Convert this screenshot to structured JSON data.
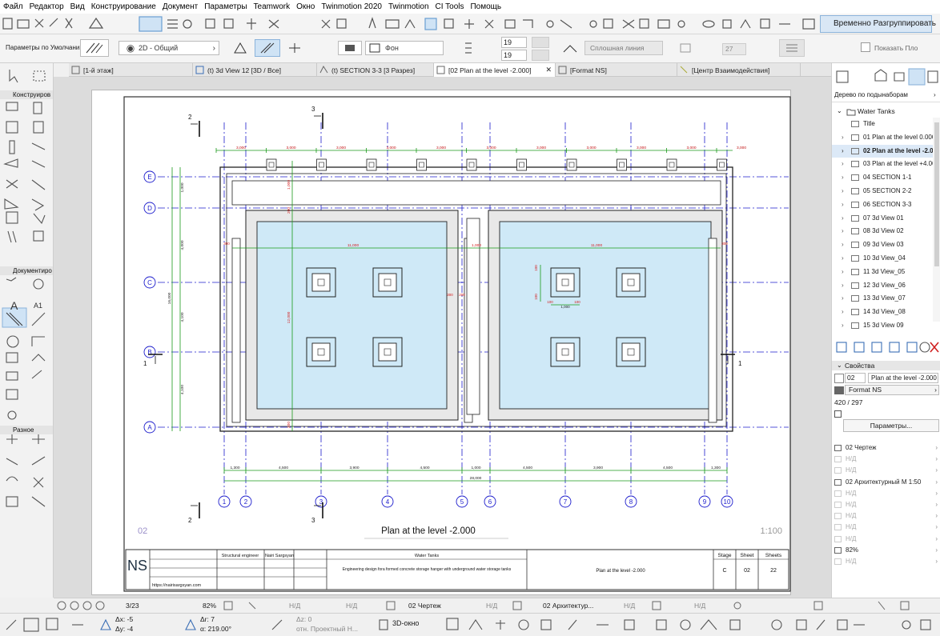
{
  "menu": [
    "Файл",
    "Редактор",
    "Вид",
    "Конструирование",
    "Документ",
    "Параметры",
    "Teamwork",
    "Окно",
    "Twinmotion 2020",
    "Twinmotion",
    "CI Tools",
    "Помощь"
  ],
  "toolbar": {
    "layer_value": "19",
    "pen_value": "19",
    "line_type": "Сплошная линия",
    "fill_value": "Фон",
    "zoom_field": "27",
    "show_label": "Показать Пло",
    "regroup_label": "Временно Разгруппировать",
    "defaults_label": "Параметры по Умолчанию",
    "view_label": "2D - Общий"
  },
  "tabs": [
    {
      "label": "[1-й этаж]",
      "icon": "floor-plan-icon"
    },
    {
      "label": "(t) 3d View 12 [3D / Все]",
      "icon": "3d-view-icon"
    },
    {
      "label": "(t) SECTION 3-3 [3 Разрез]",
      "icon": "section-icon"
    },
    {
      "label": "[02 Plan at the level -2.000]",
      "icon": "layout-icon",
      "active": true
    },
    {
      "label": "[Format NS]",
      "icon": "master-icon"
    },
    {
      "label": "[Центр Взаимодействия]",
      "icon": "collab-icon"
    }
  ],
  "left_sections": [
    "Конструиров",
    "Документиро",
    "Разное"
  ],
  "navigator": {
    "title": "Дерево по подынаборам",
    "root": "Water Tanks",
    "items": [
      {
        "label": "Title",
        "expander": false,
        "active": false
      },
      {
        "label": "01 Plan at the level 0.000",
        "expander": true,
        "active": false
      },
      {
        "label": "02 Plan at the level -2.000",
        "expander": true,
        "active": true
      },
      {
        "label": "03 Plan at the level +4.000",
        "expander": true,
        "active": false
      },
      {
        "label": "04 SECTION 1-1",
        "expander": true,
        "active": false
      },
      {
        "label": "05 SECTION 2-2",
        "expander": true,
        "active": false
      },
      {
        "label": "06 SECTION 3-3",
        "expander": true,
        "active": false
      },
      {
        "label": "07 3d View 01",
        "expander": true,
        "active": false
      },
      {
        "label": "08 3d View 02",
        "expander": true,
        "active": false
      },
      {
        "label": "09 3d View 03",
        "expander": true,
        "active": false
      },
      {
        "label": "10 3d View_04",
        "expander": true,
        "active": false
      },
      {
        "label": "11 3d View_05",
        "expander": true,
        "active": false
      },
      {
        "label": "12 3d View_06",
        "expander": true,
        "active": false
      },
      {
        "label": "13 3d View_07",
        "expander": true,
        "active": false
      },
      {
        "label": "14 3d View_08",
        "expander": true,
        "active": false
      },
      {
        "label": "15 3d View 09",
        "expander": true,
        "active": false
      }
    ]
  },
  "properties": {
    "title": "Свойства",
    "id": "02",
    "name": "Plan at the level -2.000",
    "master": "Format NS",
    "size": "420 / 297",
    "params_button": "Параметры...",
    "rows": [
      "02 Чертеж",
      "Н/Д",
      "Н/Д",
      "02 Архитектурный М 1:50",
      "Н/Д",
      "Н/Д",
      "Н/Д",
      "Н/Д",
      "Н/Д",
      "82%",
      "Н/Д"
    ]
  },
  "drawing": {
    "sheet_number": "02",
    "title": "Plan at the level -2.000",
    "scale": "1:100",
    "axes_letters": [
      "E",
      "D",
      "C",
      "B",
      "A"
    ],
    "axes_numbers": [
      "1",
      "2",
      "3",
      "4",
      "5",
      "6",
      "7",
      "8",
      "9",
      "10"
    ],
    "dims_top": [
      "3,000",
      "3,000",
      "3,000",
      "3,000",
      "3,000",
      "3,000",
      "3,000",
      "3,000",
      "3,000",
      "3,000",
      "3,000"
    ],
    "dims_bottom": [
      "1,300",
      "4,500",
      "3,900",
      "4,500",
      "1,000",
      "4,500",
      "3,900",
      "4,500",
      "1,300"
    ],
    "dim_total": "28,000",
    "dims_left": [
      "1,000",
      "4,000",
      "4,100",
      "4,100",
      "4,000"
    ],
    "dim_left_total": "16,000",
    "dim_inner_long": "11,000",
    "dim_col_small": "1,000",
    "dim_small": [
      "100",
      "100",
      "300",
      "200"
    ],
    "section_marks": [
      "1",
      "1",
      "2",
      "2",
      "3",
      "3"
    ]
  },
  "titleblock": {
    "role": "Structural engineer",
    "name": "Nairi Sargsyan",
    "url": "https://nairisargsyan.com",
    "project": "Water Tanks",
    "description": "Engineering design fora formed concrete storage hanger with underground water storage tanks",
    "drawing": "Plan at the level -2.000",
    "stage_label": "Stage",
    "sheet_label": "Sheet",
    "sheets_label": "Sheets",
    "stage": "C",
    "sheet": "02",
    "sheets": "22"
  },
  "statusbar": {
    "page": "3/23",
    "zoom": "82%",
    "na1": "Н/Д",
    "na2": "Н/Д",
    "layout": "02 Чертеж",
    "na3": "Н/Д",
    "scale": "02 Архитектур...",
    "na4": "Н/Д",
    "na5": "Н/Д"
  },
  "bottombar": {
    "dx": "Δx: -5",
    "dy": "Δy: -4",
    "dr": "Δr: 7",
    "da": "α: 219.00°",
    "dz": "Δz: 0",
    "ref": "отн. Проектный Н...",
    "view3d": "3D-окно"
  },
  "colors": {
    "axis_blue": "#1c1ccc",
    "dim_green": "#1a9a1a",
    "dim_red": "#d42020",
    "water": "#cfe9f7",
    "active_tab": "#ffffff",
    "selection": "#cfe3f5"
  }
}
